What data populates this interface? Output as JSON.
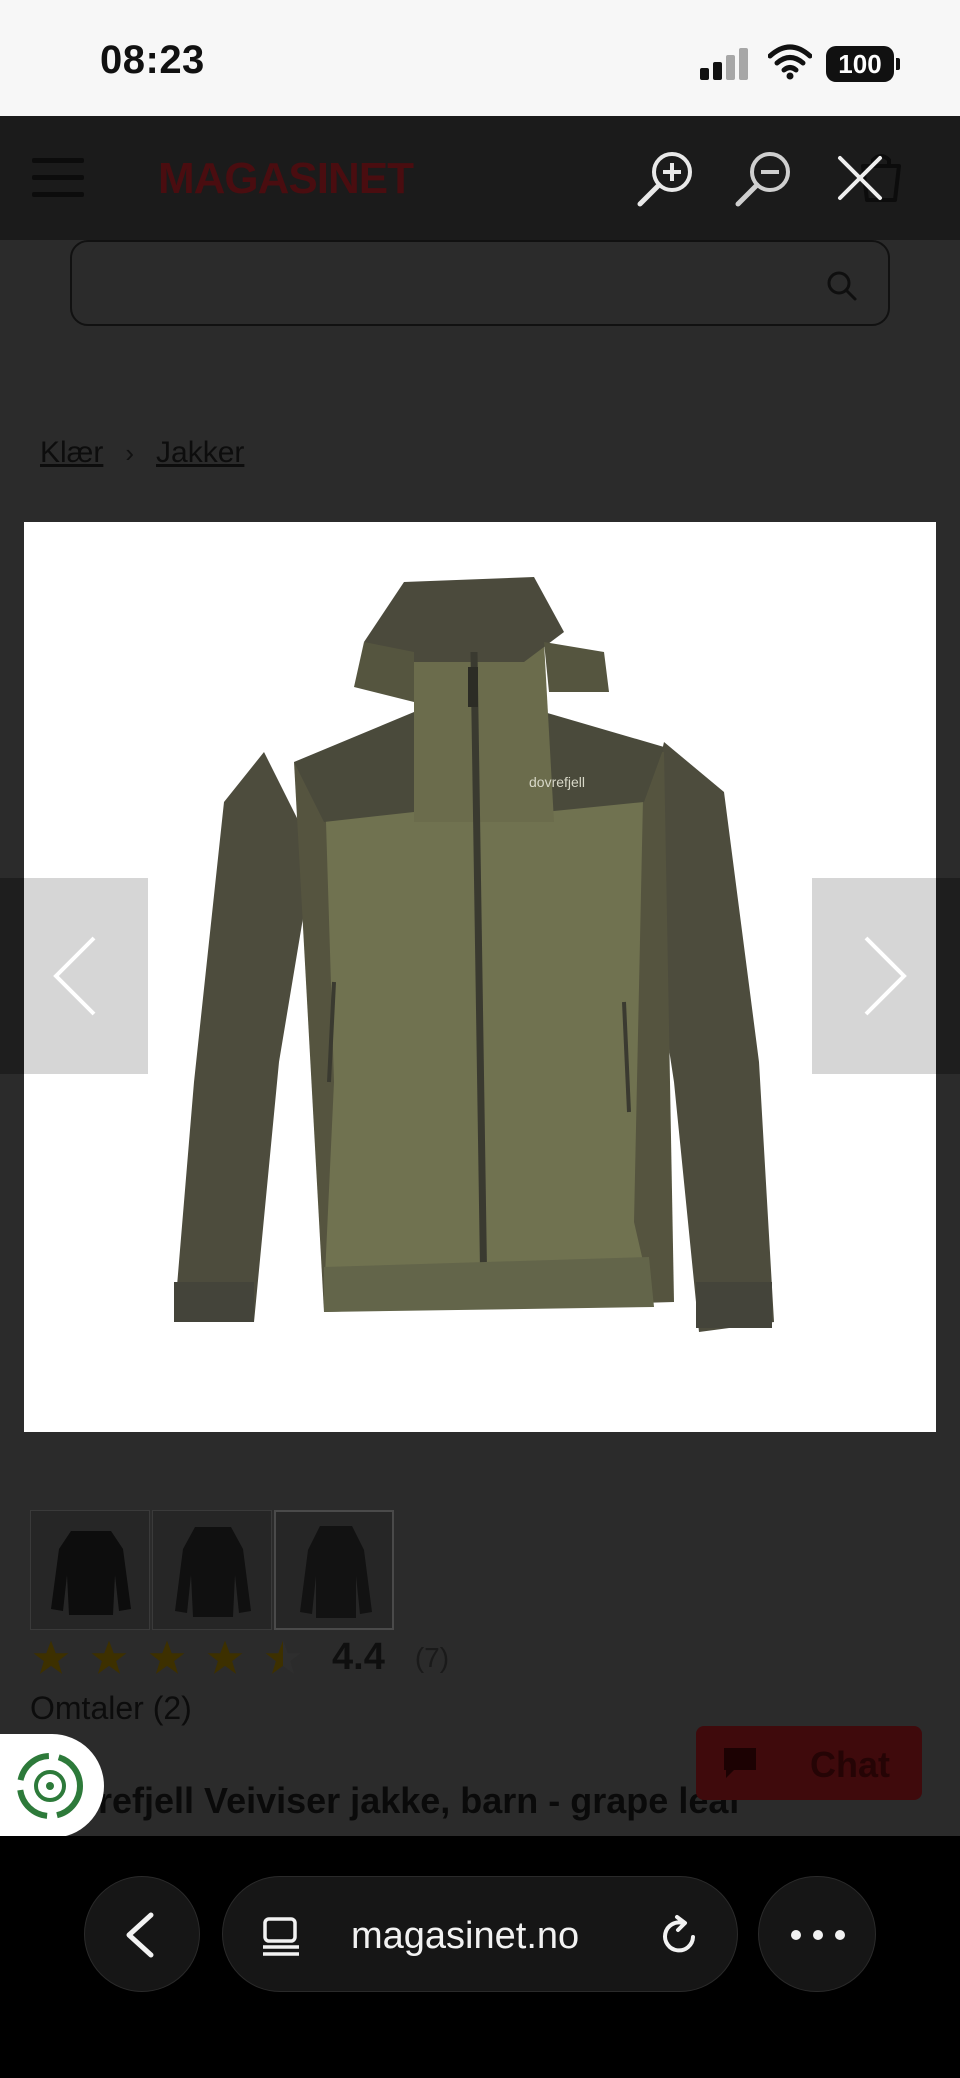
{
  "status_bar": {
    "time": "08:23",
    "battery": "100"
  },
  "header": {
    "logo": "MAGASINET"
  },
  "icons": {
    "menu": "hamburger-icon",
    "zoom_in": "zoom-in-icon",
    "zoom_out": "zoom-out-icon",
    "close": "close-icon",
    "cart": "cart-icon",
    "search": "search-icon"
  },
  "search": {
    "placeholder": ""
  },
  "breadcrumb": {
    "items": [
      "Klær",
      "Jakker"
    ]
  },
  "gallery": {
    "image_label": "dovrefjell",
    "prev_label": "‹",
    "next_label": "›",
    "thumbnail_count": 3
  },
  "rating": {
    "value": "4.4",
    "count": "(7)",
    "stars_fraction": 0.88
  },
  "reviews": {
    "label": "Omtaler (2)"
  },
  "chat": {
    "label": "Chat"
  },
  "product": {
    "title": "Dovrefjell Veiviser jakke, barn - grape leaf"
  },
  "browser": {
    "url": "magasinet.no"
  },
  "colors": {
    "overlay_dark": "#2b2b2b",
    "brand_red_dimmed": "#4a0d10",
    "jacket_olive": "#6b6d4f",
    "jacket_dark": "#4a4a3a"
  }
}
